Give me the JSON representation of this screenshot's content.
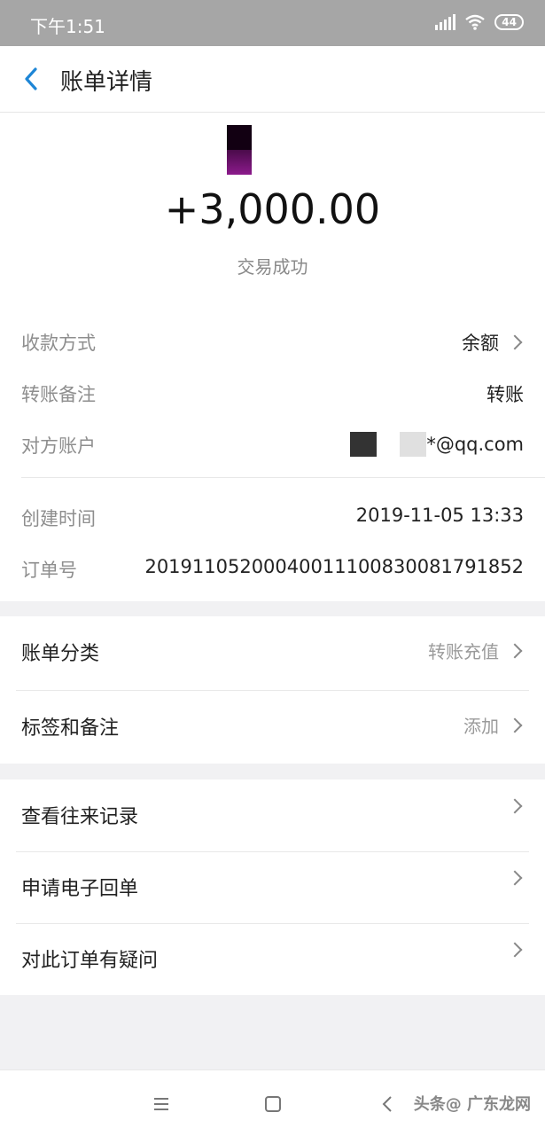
{
  "status_bar": {
    "time": "下午1:51",
    "battery": "44"
  },
  "nav": {
    "title": "账单详情"
  },
  "transaction": {
    "amount": "+3,000.00",
    "status": "交易成功",
    "details": [
      {
        "label": "收款方式",
        "value": "余额",
        "has_chevron": true
      },
      {
        "label": "转账备注",
        "value": "转账",
        "has_chevron": false
      },
      {
        "label": "对方账户",
        "value": "*@qq.com",
        "has_chevron": false
      }
    ],
    "created_time_label": "创建时间",
    "created_time": "2019-11-05 13:33",
    "order_no_label": "订单号",
    "order_no": "20191105200040011100830081791852"
  },
  "category_section": [
    {
      "label": "账单分类",
      "value": "转账充值"
    },
    {
      "label": "标签和备注",
      "value": "添加"
    }
  ],
  "actions_section": [
    {
      "label": "查看往来记录"
    },
    {
      "label": "申请电子回单"
    },
    {
      "label": "对此订单有疑问"
    }
  ],
  "footer": {
    "watermark": "头条@ 广东龙网"
  },
  "icons": {
    "back": "chevron-left-icon",
    "menu": "menu-icon",
    "home": "square-home-icon",
    "back_sys": "triangle-back-icon"
  },
  "colors": {
    "accent": "#1e86d6"
  }
}
